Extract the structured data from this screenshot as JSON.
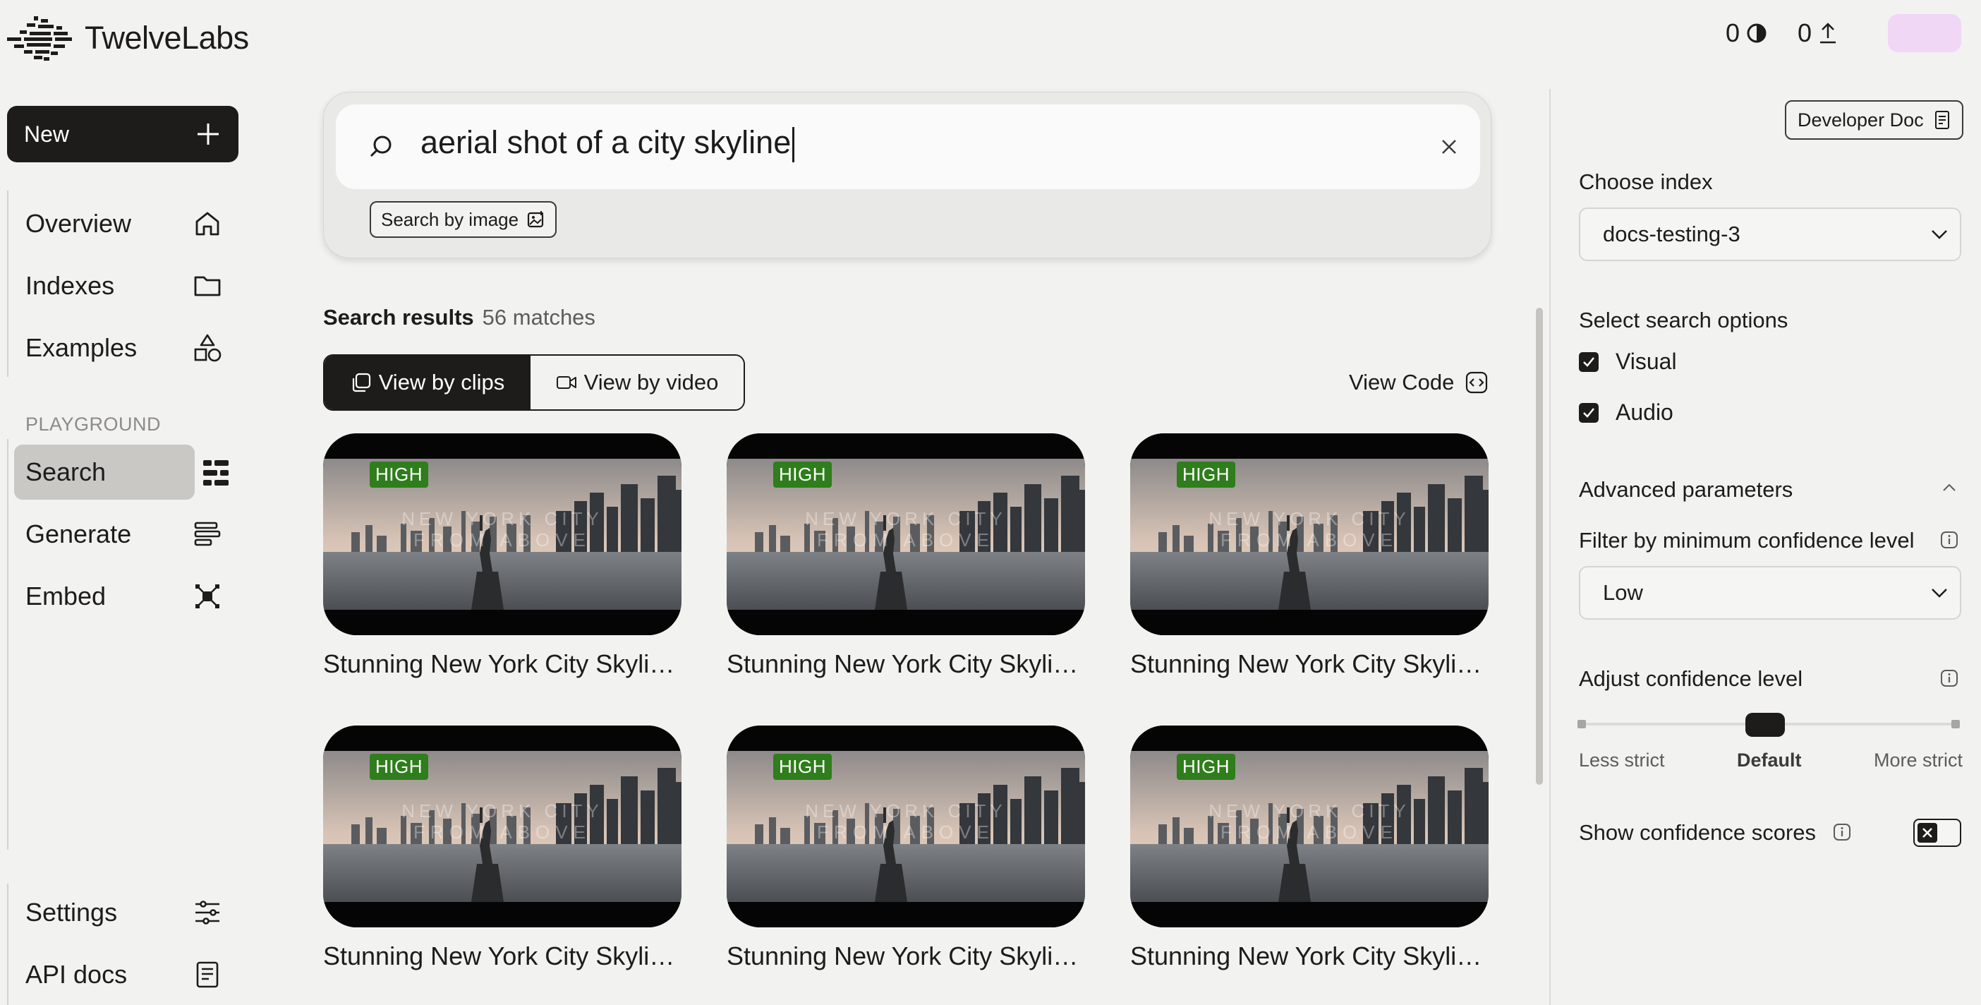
{
  "app": {
    "name": "TwelveLabs"
  },
  "header": {
    "stat_a": "0",
    "stat_b": "0"
  },
  "sidebar": {
    "new_label": "New",
    "items": [
      {
        "label": "Overview",
        "icon": "home-icon"
      },
      {
        "label": "Indexes",
        "icon": "folder-icon"
      },
      {
        "label": "Examples",
        "icon": "shapes-icon"
      }
    ],
    "section_label": "PLAYGROUND",
    "playground": [
      {
        "label": "Search",
        "icon": "search-grid-icon",
        "active": true
      },
      {
        "label": "Generate",
        "icon": "text-lines-icon"
      },
      {
        "label": "Embed",
        "icon": "embed-nodes-icon"
      }
    ],
    "bottom": [
      {
        "label": "Settings",
        "icon": "sliders-icon"
      },
      {
        "label": "API docs",
        "icon": "book-icon"
      }
    ]
  },
  "search": {
    "query": "aerial shot of a city skyline",
    "image_button": "Search by image"
  },
  "results": {
    "label": "Search results",
    "count": "56 matches",
    "view_clips": "View by clips",
    "view_video": "View by video",
    "view_code": "View Code",
    "cards": [
      {
        "badge": "HIGH",
        "title": "Stunning New York City Skylin..."
      },
      {
        "badge": "HIGH",
        "title": "Stunning New York City Skylin..."
      },
      {
        "badge": "HIGH",
        "title": "Stunning New York City Skylin..."
      },
      {
        "badge": "HIGH",
        "title": "Stunning New York City Skylin..."
      },
      {
        "badge": "HIGH",
        "title": "Stunning New York City Skylin..."
      },
      {
        "badge": "HIGH",
        "title": "Stunning New York City Skylin..."
      }
    ]
  },
  "panel": {
    "dev_doc": "Developer Doc",
    "choose_index_label": "Choose index",
    "index_value": "docs-testing-3",
    "search_options_label": "Select search options",
    "option_visual": "Visual",
    "option_audio": "Audio",
    "advanced_label": "Advanced parameters",
    "filter_label": "Filter by minimum confidence level",
    "filter_value": "Low",
    "adjust_label": "Adjust confidence level",
    "slider_less": "Less strict",
    "slider_default": "Default",
    "slider_more": "More strict",
    "show_scores_label": "Show confidence scores"
  },
  "colors": {
    "accent": "#1d1c1b",
    "badge_green": "#2f7d1c",
    "background": "#f2f2f1"
  }
}
